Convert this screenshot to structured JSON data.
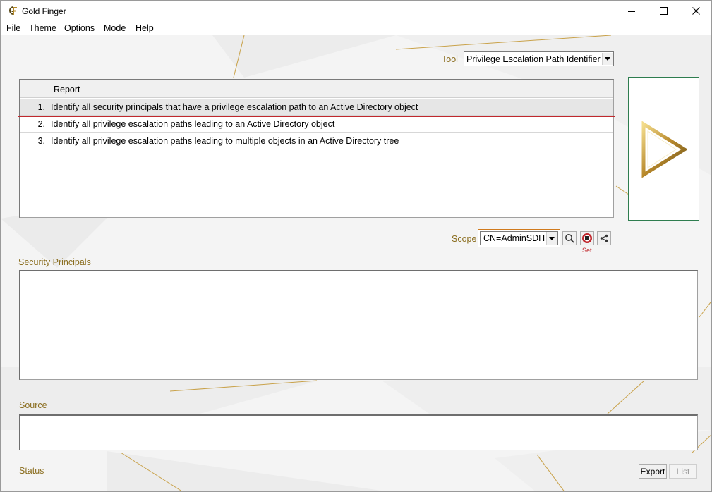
{
  "window": {
    "title": "Gold Finger",
    "icon": "goldfinger-app-icon"
  },
  "menu": [
    "File",
    "Theme",
    "Options",
    "Mode",
    "Help"
  ],
  "tool": {
    "label": "Tool",
    "selected": "Privilege Escalation Path Identifier"
  },
  "report_table": {
    "header": "Report",
    "rows": [
      {
        "num": "1.",
        "text": "Identify all security principals that have a privilege escalation path to an Active Directory object",
        "selected": true
      },
      {
        "num": "2.",
        "text": "Identify all privilege escalation paths leading to an Active Directory object"
      },
      {
        "num": "3.",
        "text": "Identify all privilege escalation paths leading to multiple objects in an Active Directory tree"
      }
    ]
  },
  "run_button_icon": "play-icon",
  "scope": {
    "label": "Scope",
    "selected": "CN=AdminSDH",
    "buttons": [
      "search-icon",
      "set-icon",
      "share-icon"
    ],
    "set_label": "Set"
  },
  "security_principals": {
    "label": "Security Principals"
  },
  "source": {
    "label": "Source"
  },
  "status": {
    "label": "Status"
  },
  "buttons": {
    "export": "Export",
    "list": "List"
  },
  "colors": {
    "accent_gold": "#8a6d1e",
    "selection_outline": "#c0282d",
    "run_border": "#2e7d4f"
  }
}
